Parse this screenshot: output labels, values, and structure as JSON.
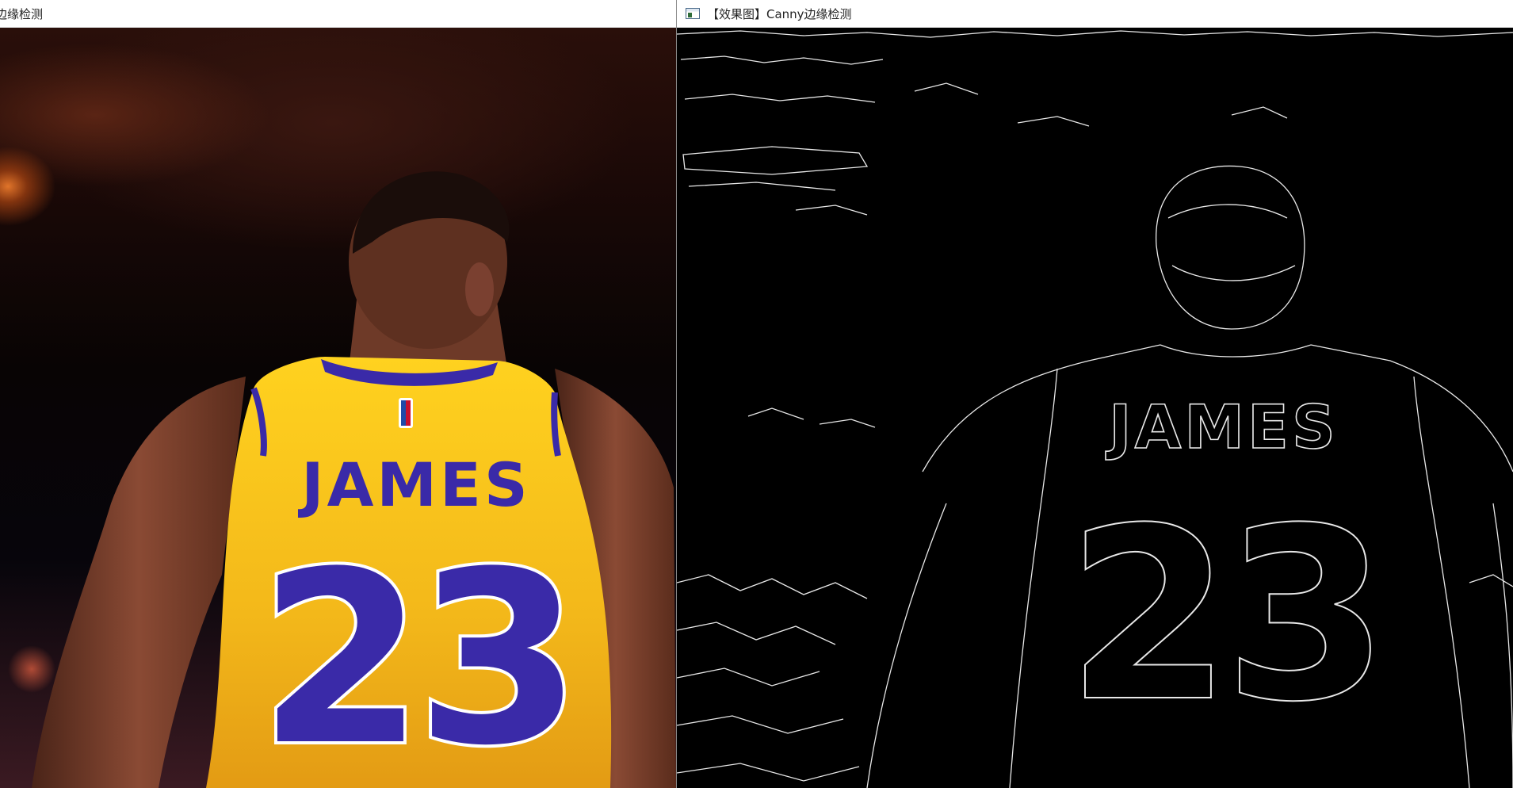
{
  "left_window": {
    "title": "边缘检测",
    "jersey": {
      "name": "JAMES",
      "number": "23"
    }
  },
  "right_window": {
    "title": "【效果图】Canny边缘检测",
    "jersey": {
      "name": "JAMES",
      "number": "23"
    }
  },
  "colors": {
    "jersey_gold": "#f5c11d",
    "jersey_purple": "#3a2aa8",
    "edge_white": "#e8e8e8",
    "edge_background": "#000000"
  }
}
